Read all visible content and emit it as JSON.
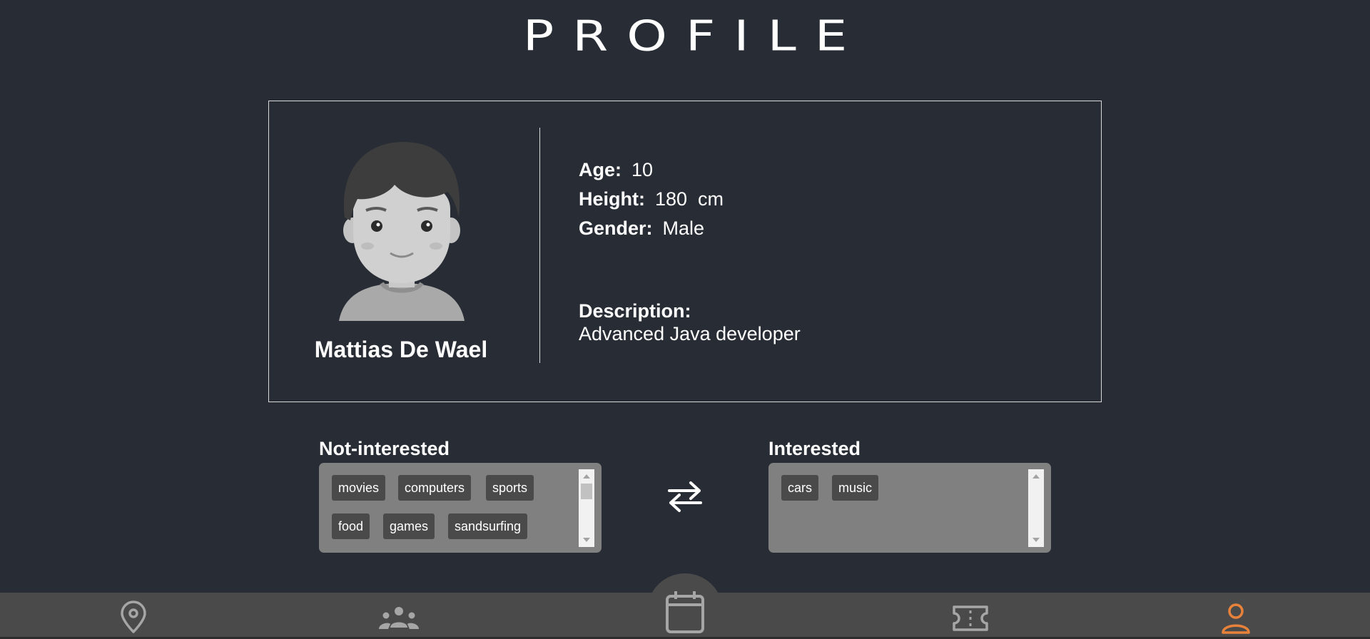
{
  "header": {
    "title": "PROFILE"
  },
  "profile": {
    "name": "Mattias De Wael",
    "age_label": "Age:",
    "age_value": "10",
    "height_label": "Height:",
    "height_value": "180  cm",
    "gender_label": "Gender:",
    "gender_value": "Male",
    "description_label": "Description:",
    "description_value": "Advanced Java developer",
    "avatar_icon": "boy-avatar-icon"
  },
  "not_interested": {
    "title": "Not-interested",
    "tags": [
      "movies",
      "computers",
      "sports",
      "food",
      "games",
      "sandsurfing"
    ]
  },
  "interested": {
    "title": "Interested",
    "tags": [
      "cars",
      "music"
    ]
  },
  "swap_icon": "swap-arrows-icon",
  "bottom_nav": {
    "items": [
      {
        "icon": "location-pin-icon",
        "active": false
      },
      {
        "icon": "group-people-icon",
        "active": false
      },
      {
        "icon": "calendar-icon",
        "active": false
      },
      {
        "icon": "ticket-icon",
        "active": false
      },
      {
        "icon": "user-profile-icon",
        "active": true
      }
    ],
    "active_color": "#e8823a",
    "inactive_color": "#a6a6a6"
  },
  "colors": {
    "background": "#282d35",
    "tag_box": "#808080",
    "tag": "#4a4a4a",
    "nav_bar": "#4a4a4a"
  }
}
